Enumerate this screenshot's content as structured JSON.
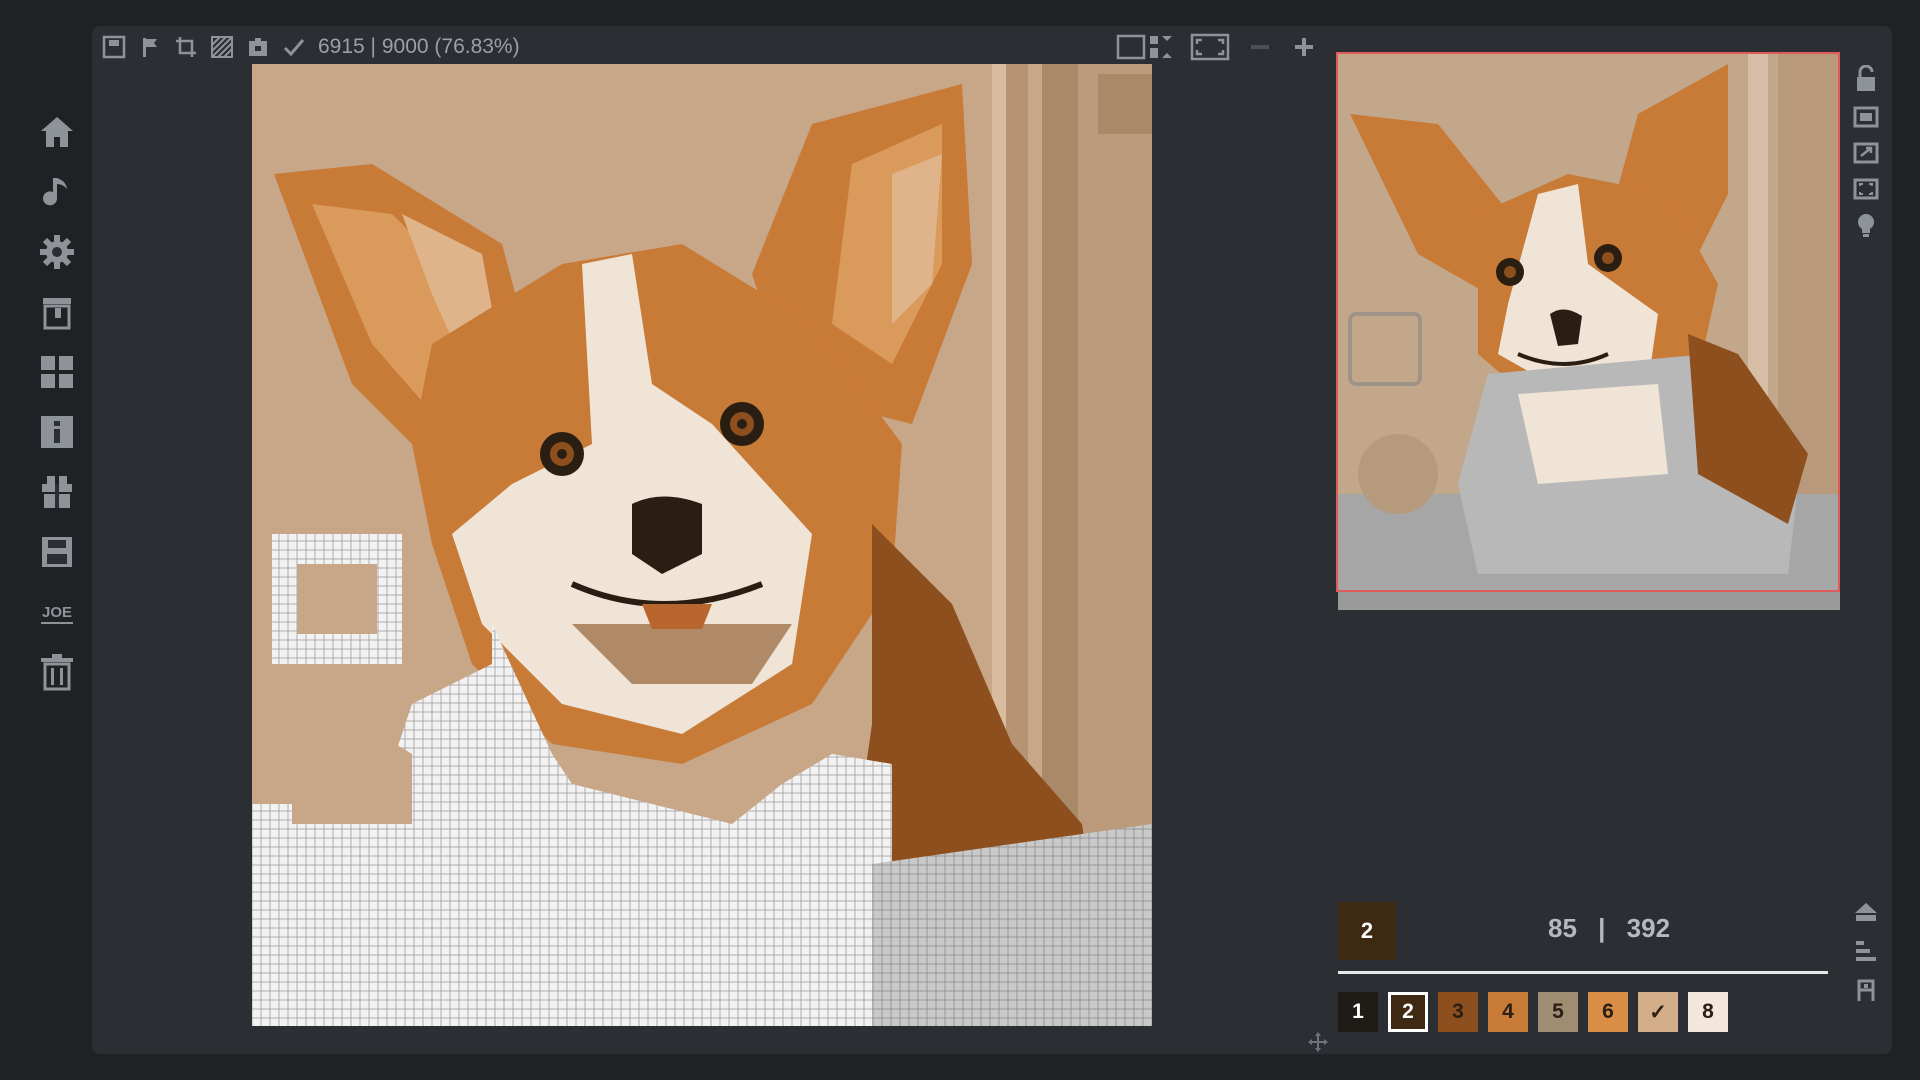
{
  "toolbar": {
    "progress": "6915 | 9000 (76.83%)",
    "left_icons": [
      "save-icon",
      "flag-icon",
      "crop-icon",
      "hatch-icon",
      "puzzle-icon",
      "check-icon"
    ],
    "right_icons": [
      "layout-icon",
      "fullscreen-icon",
      "zoom-out-icon",
      "zoom-in-icon"
    ]
  },
  "sidebar": {
    "items": [
      {
        "icon": "home-icon"
      },
      {
        "icon": "music-icon"
      },
      {
        "icon": "settings-icon"
      },
      {
        "icon": "paint-bucket-icon"
      },
      {
        "icon": "dashboard-icon"
      },
      {
        "icon": "info-icon"
      },
      {
        "icon": "gift-icon"
      },
      {
        "icon": "save-disk-icon"
      },
      {
        "icon": "joe-logo-icon",
        "label": "JOE"
      },
      {
        "icon": "trash-icon"
      }
    ]
  },
  "current_color": {
    "number": "2",
    "color": "#3e2a12"
  },
  "counts": {
    "filled": "85",
    "separator": "|",
    "total": "392"
  },
  "palette": [
    {
      "label": "1",
      "color": "#1f1c17",
      "text": "#ffffff"
    },
    {
      "label": "2",
      "color": "#3e2a12",
      "text": "#ffffff",
      "selected": true
    },
    {
      "label": "3",
      "color": "#8e4f1f",
      "text": "#2b2016"
    },
    {
      "label": "4",
      "color": "#c87a37",
      "text": "#2b2016"
    },
    {
      "label": "5",
      "color": "#a08b73",
      "text": "#2b2016"
    },
    {
      "label": "6",
      "color": "#d98d45",
      "text": "#2b2016"
    },
    {
      "label": "✓",
      "color": "#d2ad87",
      "text": "#2b2016"
    },
    {
      "label": "8",
      "color": "#f2e7da",
      "text": "#2b2016"
    }
  ],
  "colors": {
    "background": "#c8a789",
    "fur_orange": "#c87a37",
    "fur_dark": "#8e4f1f",
    "fur_light": "#e0b48a",
    "white_fur": "#efe4d6",
    "unpainted_grid": "#ffffff",
    "preview_border": "#e05a5a"
  }
}
